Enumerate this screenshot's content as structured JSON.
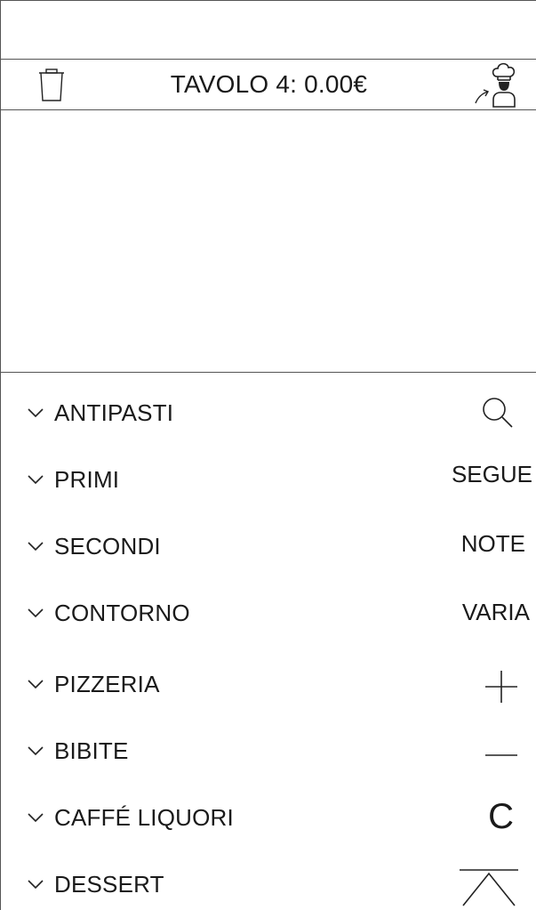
{
  "header": {
    "title": "TAVOLO 4: 0.00€",
    "trash_icon": "trash-icon",
    "chef_icon": "chef-send-icon"
  },
  "categories": [
    {
      "label": "ANTIPASTI"
    },
    {
      "label": "PRIMI"
    },
    {
      "label": "SECONDI"
    },
    {
      "label": "CONTORNO"
    },
    {
      "label": "PIZZERIA"
    },
    {
      "label": "BIBITE"
    },
    {
      "label": "CAFFÉ LIQUORI"
    },
    {
      "label": "DESSERT"
    }
  ],
  "actions": {
    "search_icon": "search-icon",
    "segue_label": "SEGUE",
    "note_label": "NOTE",
    "varia_label": "VARIA",
    "plus_icon": "plus-icon",
    "minus_icon": "minus-icon",
    "clear_label": "C",
    "collapse_icon": "chevron-up-icon"
  }
}
